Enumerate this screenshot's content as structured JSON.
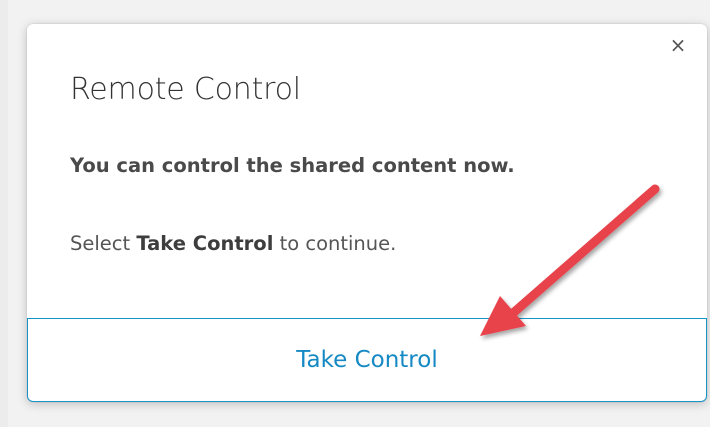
{
  "dialog": {
    "close_glyph": "×",
    "title": "Remote Control",
    "message": "You can control the shared content now.",
    "instruction": {
      "prefix": "Select ",
      "emphasis": "Take Control",
      "suffix": " to continue."
    },
    "primary_button_label": "Take Control"
  },
  "annotation": {
    "arrow_color": "#e8434b"
  }
}
